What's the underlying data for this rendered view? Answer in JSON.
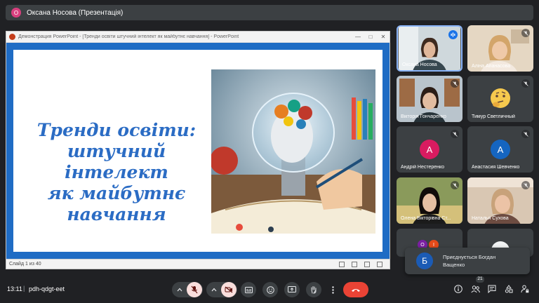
{
  "presenter": {
    "avatar_letter": "О",
    "label": "Оксана Носова (Презентація)"
  },
  "powerpoint": {
    "window_title": "Демонстрация PowerPoint - [Тренди освіти штучний інтелект як майбутнє навчання] - PowerPoint",
    "slide_title_lines": [
      "Тренди освіти:",
      "штучний інтелект",
      "як майбутнє",
      "навчання"
    ],
    "slide_counter": "Слайд 1 из 40"
  },
  "participants": [
    {
      "name": "Оксана Носова",
      "speaking": true
    },
    {
      "name": "Аліна Апанасова",
      "muted": true
    },
    {
      "name": "Вікторія Гончаренко",
      "muted": true
    },
    {
      "name": "Тимур Светличный",
      "muted": true
    },
    {
      "name": "Андрій Нестеренко",
      "avatar_letter": "А",
      "avatar_color": "#d81b60",
      "muted": true
    },
    {
      "name": "Анастасия Шевченко",
      "avatar_letter": "А",
      "avatar_color": "#1565c0",
      "muted": true
    },
    {
      "name": "Олена Вікторівна Ст...",
      "muted": true
    },
    {
      "name": "Наталья Сухова",
      "muted": true
    }
  ],
  "overflow_tile": {
    "letters": [
      "О",
      "І"
    ]
  },
  "toast": {
    "avatar_letter": "Б",
    "text": "Приєднується Богдан Ващенко"
  },
  "bottom_bar": {
    "time": "13:11",
    "separator": "|",
    "meeting_code": "pdh-qdgt-eet",
    "participant_count": "21"
  },
  "colors": {
    "background": "#202124",
    "tile": "#3c4043",
    "accent": "#8ab4f8",
    "danger": "#ea4335",
    "muted_control": "#f9dedc",
    "slide_frame": "#1f6cc4",
    "slide_title": "#2b6cc4"
  }
}
